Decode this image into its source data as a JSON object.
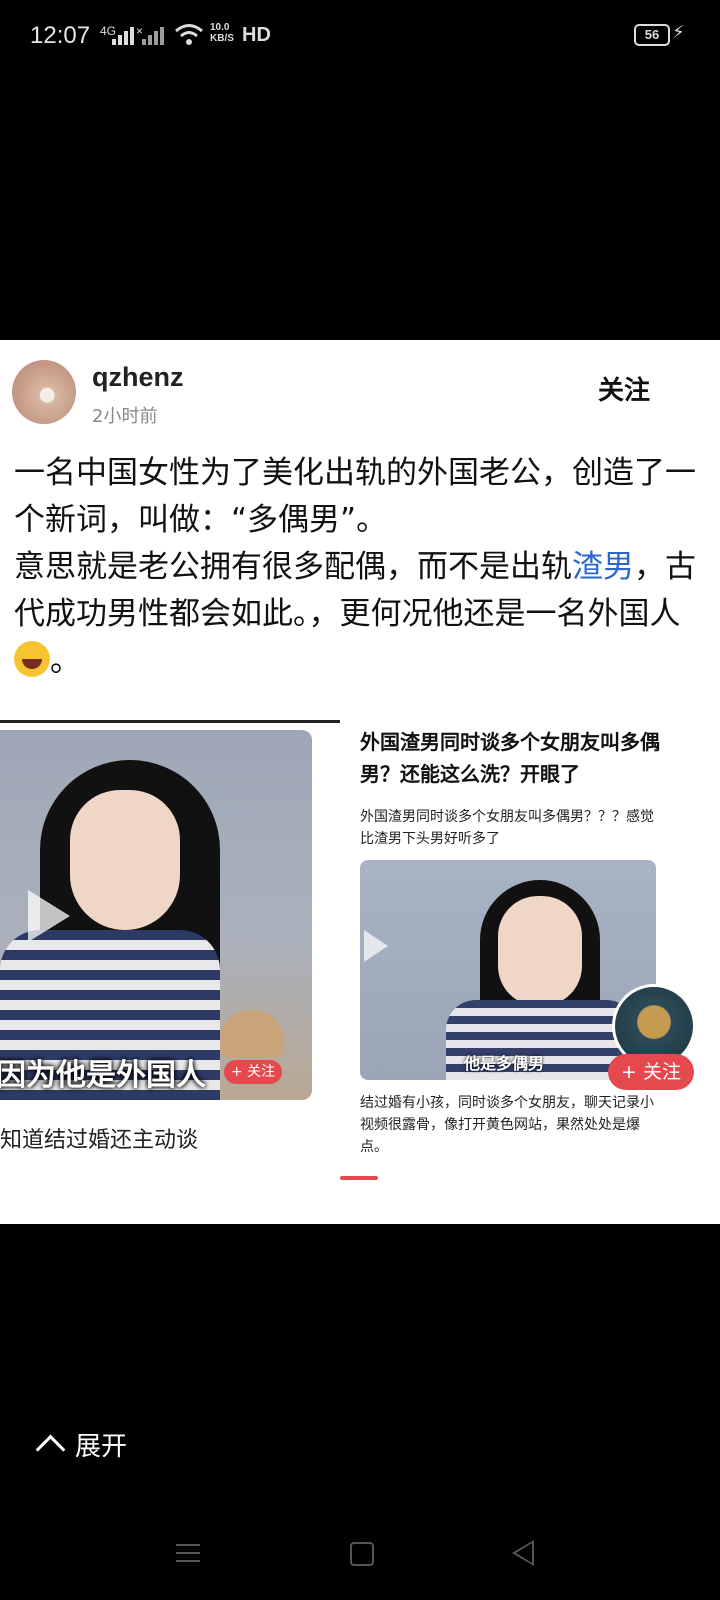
{
  "status_bar": {
    "time": "12:07",
    "network_1": "4G",
    "network_2": "×",
    "speed": "10.0\nKB/S",
    "hd": "HD",
    "battery": "56"
  },
  "post": {
    "username": "qzhenz",
    "time_ago": "2小时前",
    "follow_label": "关注",
    "text_part1": "一名中国女性为了美化出轨的外国老公，创造了一个新词，叫做：“多偶男”。",
    "text_part2": "意思就是老公拥有很多配偶，而不是出轨",
    "text_link": "渣男",
    "text_part3": "，古代成功男性都会如此。，更何况他还是一名外国人",
    "text_end": "。"
  },
  "embed": {
    "left_caption": "因为他是外国人",
    "left_follow": "+ 关注",
    "left_bottom_text": "知道结过婚还主动谈",
    "right_title": "外国渣男同时谈多个女朋友叫多偶男？还能这么洗？开眼了",
    "right_desc": "外国渣男同时谈多个女朋友叫多偶男？？？感觉比渣男下头男好听多了",
    "right_caption": "他是多偶男",
    "right_footer": "结过婚有小孩，同时谈多个女朋友，聊天记录小视频很露骨，像打开黄色网站，果然处处是爆点。",
    "right_follow": "+ 关注"
  },
  "expand_label": "展开",
  "colors": {
    "link": "#2a67c8",
    "follow_red": "#e5484d",
    "background": "#000000"
  }
}
